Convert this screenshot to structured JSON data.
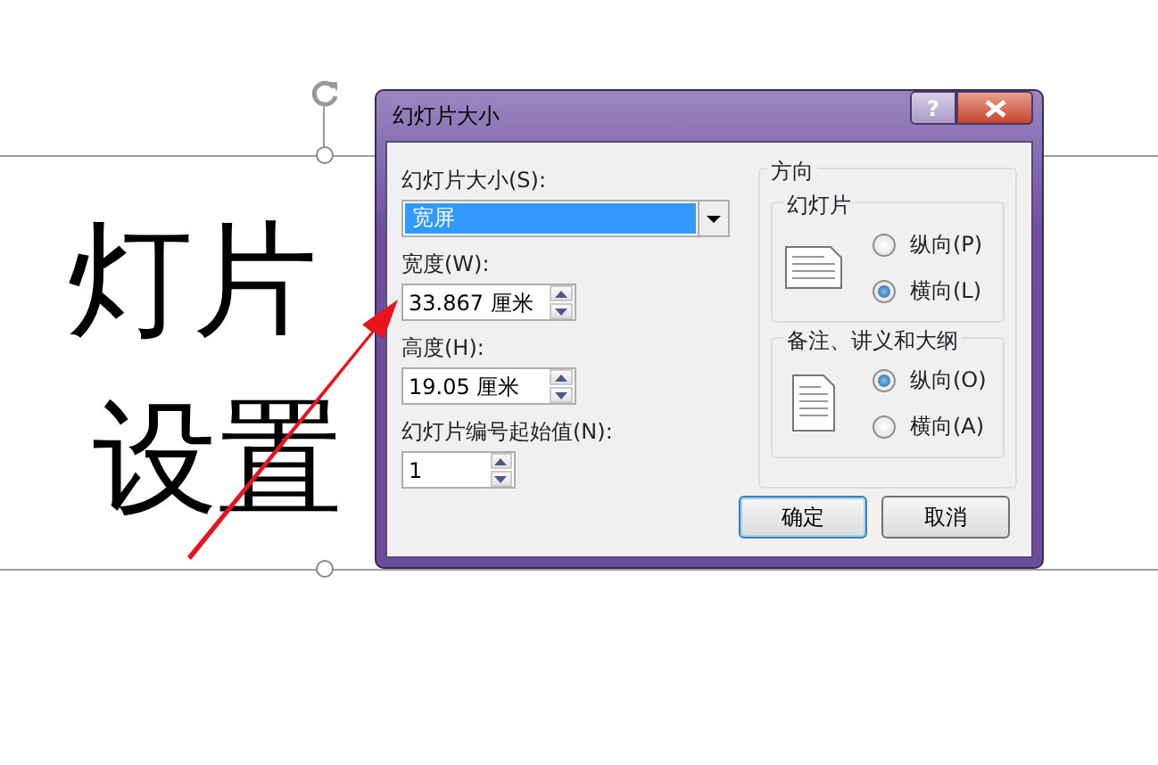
{
  "slide": {
    "title_lines": [
      "灯片",
      "设置"
    ]
  },
  "dialog": {
    "title": "幻灯片大小",
    "help": "?",
    "size_label": "幻灯片大小(S):",
    "size_value": "宽屏",
    "width_label": "宽度(W):",
    "width_value": "33.867 厘米",
    "height_label": "高度(H):",
    "height_value": "19.05 厘米",
    "start_label": "幻灯片编号起始值(N):",
    "start_value": "1",
    "orientation": {
      "title": "方向",
      "groups": [
        {
          "title": "幻灯片",
          "kind": "landscape",
          "options": [
            {
              "label": "纵向(P)",
              "selected": false
            },
            {
              "label": "横向(L)",
              "selected": true
            }
          ]
        },
        {
          "title": "备注、讲义和大纲",
          "kind": "portrait",
          "options": [
            {
              "label": "纵向(O)",
              "selected": true
            },
            {
              "label": "横向(A)",
              "selected": false
            }
          ]
        }
      ]
    },
    "buttons": [
      {
        "label": "确定",
        "default": true
      },
      {
        "label": "取消",
        "default": false
      }
    ]
  }
}
